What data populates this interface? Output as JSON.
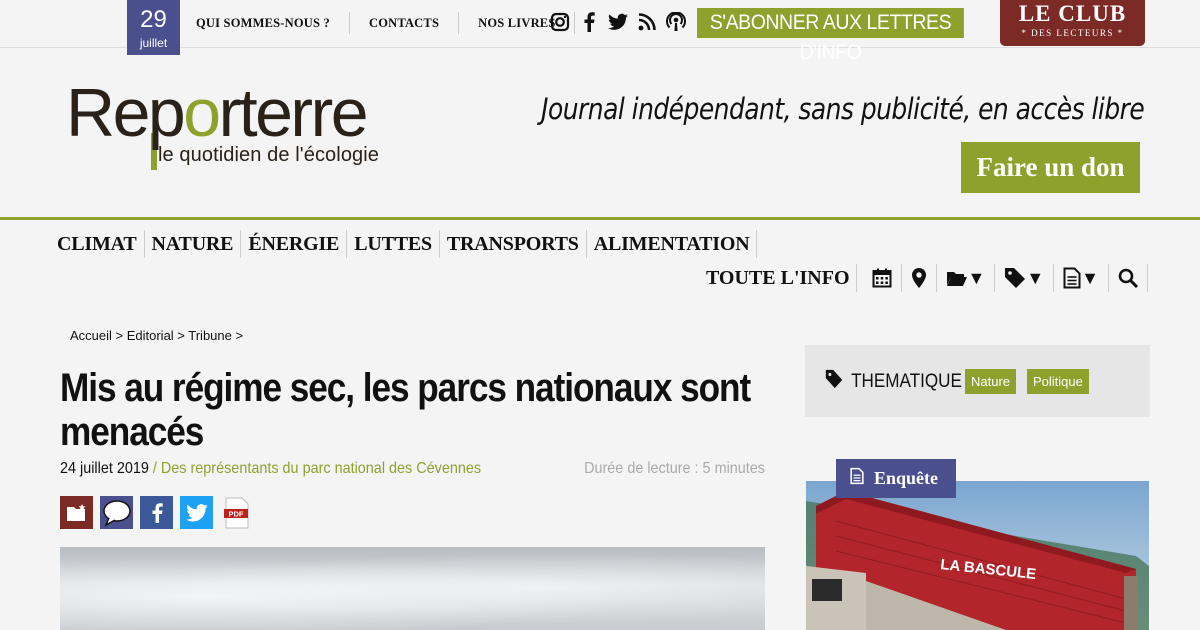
{
  "date": {
    "day": "29",
    "month": "juillet"
  },
  "top_nav": [
    "QUI SOMMES-NOUS ?",
    "CONTACTS",
    "NOS LIVRES"
  ],
  "social_icons": [
    "instagram-icon",
    "facebook-icon",
    "twitter-icon",
    "rss-icon",
    "podcast-icon"
  ],
  "subscribe_label": "S'ABONNER AUX LETTRES D'INFO",
  "club": {
    "line1": "LE CLUB",
    "line2": "* DES LECTEURS *"
  },
  "logo": {
    "pre": "Rep",
    "o": "o",
    "post": "rterre",
    "tagline": "le quotidien de l'écologie"
  },
  "slogan": "Journal indépendant, sans publicité, en accès libre",
  "donate_label": "Faire un don",
  "main_nav": [
    "CLIMAT",
    "NATURE",
    "ÉNERGIE",
    "LUTTES",
    "TRANSPORTS",
    "ALIMENTATION"
  ],
  "sub_nav": {
    "all_label": "TOUTE L'INFO",
    "icons": [
      "calendar-icon",
      "map-pin-icon",
      "folder-icon",
      "tag-icon",
      "document-icon",
      "search-icon"
    ],
    "arrow": "▼"
  },
  "breadcrumb": "Accueil > Editorial > Tribune >",
  "article": {
    "title": "Mis au régime sec, les parcs nationaux sont menacés",
    "date": "24 juillet 2019",
    "author_sep": " / ",
    "author": "Des représentants du parc national des Cévennes",
    "reading_time": "Durée de lecture : 5 minutes"
  },
  "share_icons": [
    "save-folder-icon",
    "comment-icon",
    "facebook-share-icon",
    "twitter-share-icon",
    "pdf-icon"
  ],
  "pdf_label": "PDF",
  "thematique": {
    "label": "THEMATIQUE",
    "tags": [
      "Nature",
      "Politique"
    ]
  },
  "enquete": {
    "label": "Enquête",
    "building_sign": "LA BASCULE"
  },
  "colors": {
    "green": "#8ea12d",
    "purple": "#4a4f8e",
    "burgundy": "#7c2a25"
  }
}
